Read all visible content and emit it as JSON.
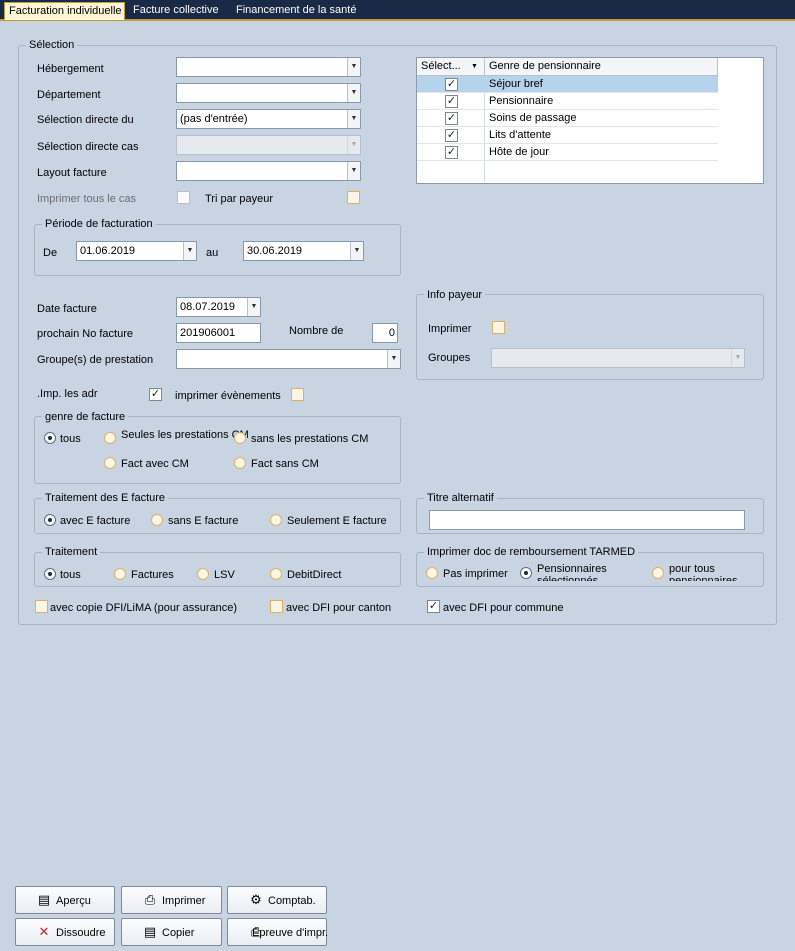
{
  "tabs": [
    "Facturation individuelle",
    "Facture collective",
    "Financement de la santé"
  ],
  "selection": {
    "title": "Sélection",
    "hebergement_label": "Hébergement",
    "departement_label": "Département",
    "selection_du_label": "Sélection directe du",
    "selection_du_value": "(pas d'entrée)",
    "selection_cas_label": "Sélection directe cas",
    "layout_label": "Layout facture",
    "imprimer_tous_label": "Imprimer tous le cas",
    "tri_payeur_label": "Tri par payeur"
  },
  "grid": {
    "col_select": "Sélect...",
    "col_genre": "Genre de pensionnaire",
    "rows": [
      "Séjour bref",
      "Pensionnaire",
      "Soins de passage",
      "Lits d'attente",
      "Hôte de jour"
    ]
  },
  "periode": {
    "title": "Période de facturation",
    "de_label": "De",
    "de_value": "01.06.2019",
    "au_label": "au",
    "au_value": "30.06.2019"
  },
  "facture": {
    "date_label": "Date facture",
    "date_value": "08.07.2019",
    "no_label": "prochain No facture",
    "no_value": "201906001",
    "nombre_label": "Nombre de",
    "nombre_value": "0",
    "groupes_label": "Groupe(s) de prestation",
    "imp_adr_label": ".Imp. les adr",
    "evenements_label": "imprimer évènements"
  },
  "info_payeur": {
    "title": "Info payeur",
    "imprimer_label": "Imprimer",
    "groupes_label": "Groupes"
  },
  "genre_facture": {
    "title": "genre de facture",
    "tous": "tous",
    "seules_cm": "Seules les prestations CM",
    "sans_cm": "sans les prestations CM",
    "fact_avec_cm": "Fact avec CM",
    "fact_sans_cm": "Fact sans CM"
  },
  "efacture": {
    "title": "Traitement des E facture",
    "avec": "avec E facture",
    "sans": "sans E facture",
    "seulement": "Seulement E facture"
  },
  "titre_alt": {
    "title": "Titre alternatif"
  },
  "traitement": {
    "title": "Traitement",
    "tous": "tous",
    "factures": "Factures",
    "lsv": "LSV",
    "debit": "DebitDirect"
  },
  "tarmed": {
    "title": "Imprimer doc de remboursement TARMED",
    "pas": "Pas imprimer",
    "pens_sel": "Pensionnaires sélectionnés",
    "pour_tous": "pour tous pensionnaires"
  },
  "dfi": {
    "copie": "avec copie DFI/LiMA (pour assurance)",
    "canton": "avec DFI pour canton",
    "commune": "avec DFI pour commune"
  },
  "buttons": {
    "apercu": "Aperçu",
    "imprimer": "Imprimer",
    "comptab": "Comptab.",
    "dissoudre": "Dissoudre",
    "copier": "Copier",
    "epreuve": "Epreuve d'impr."
  }
}
